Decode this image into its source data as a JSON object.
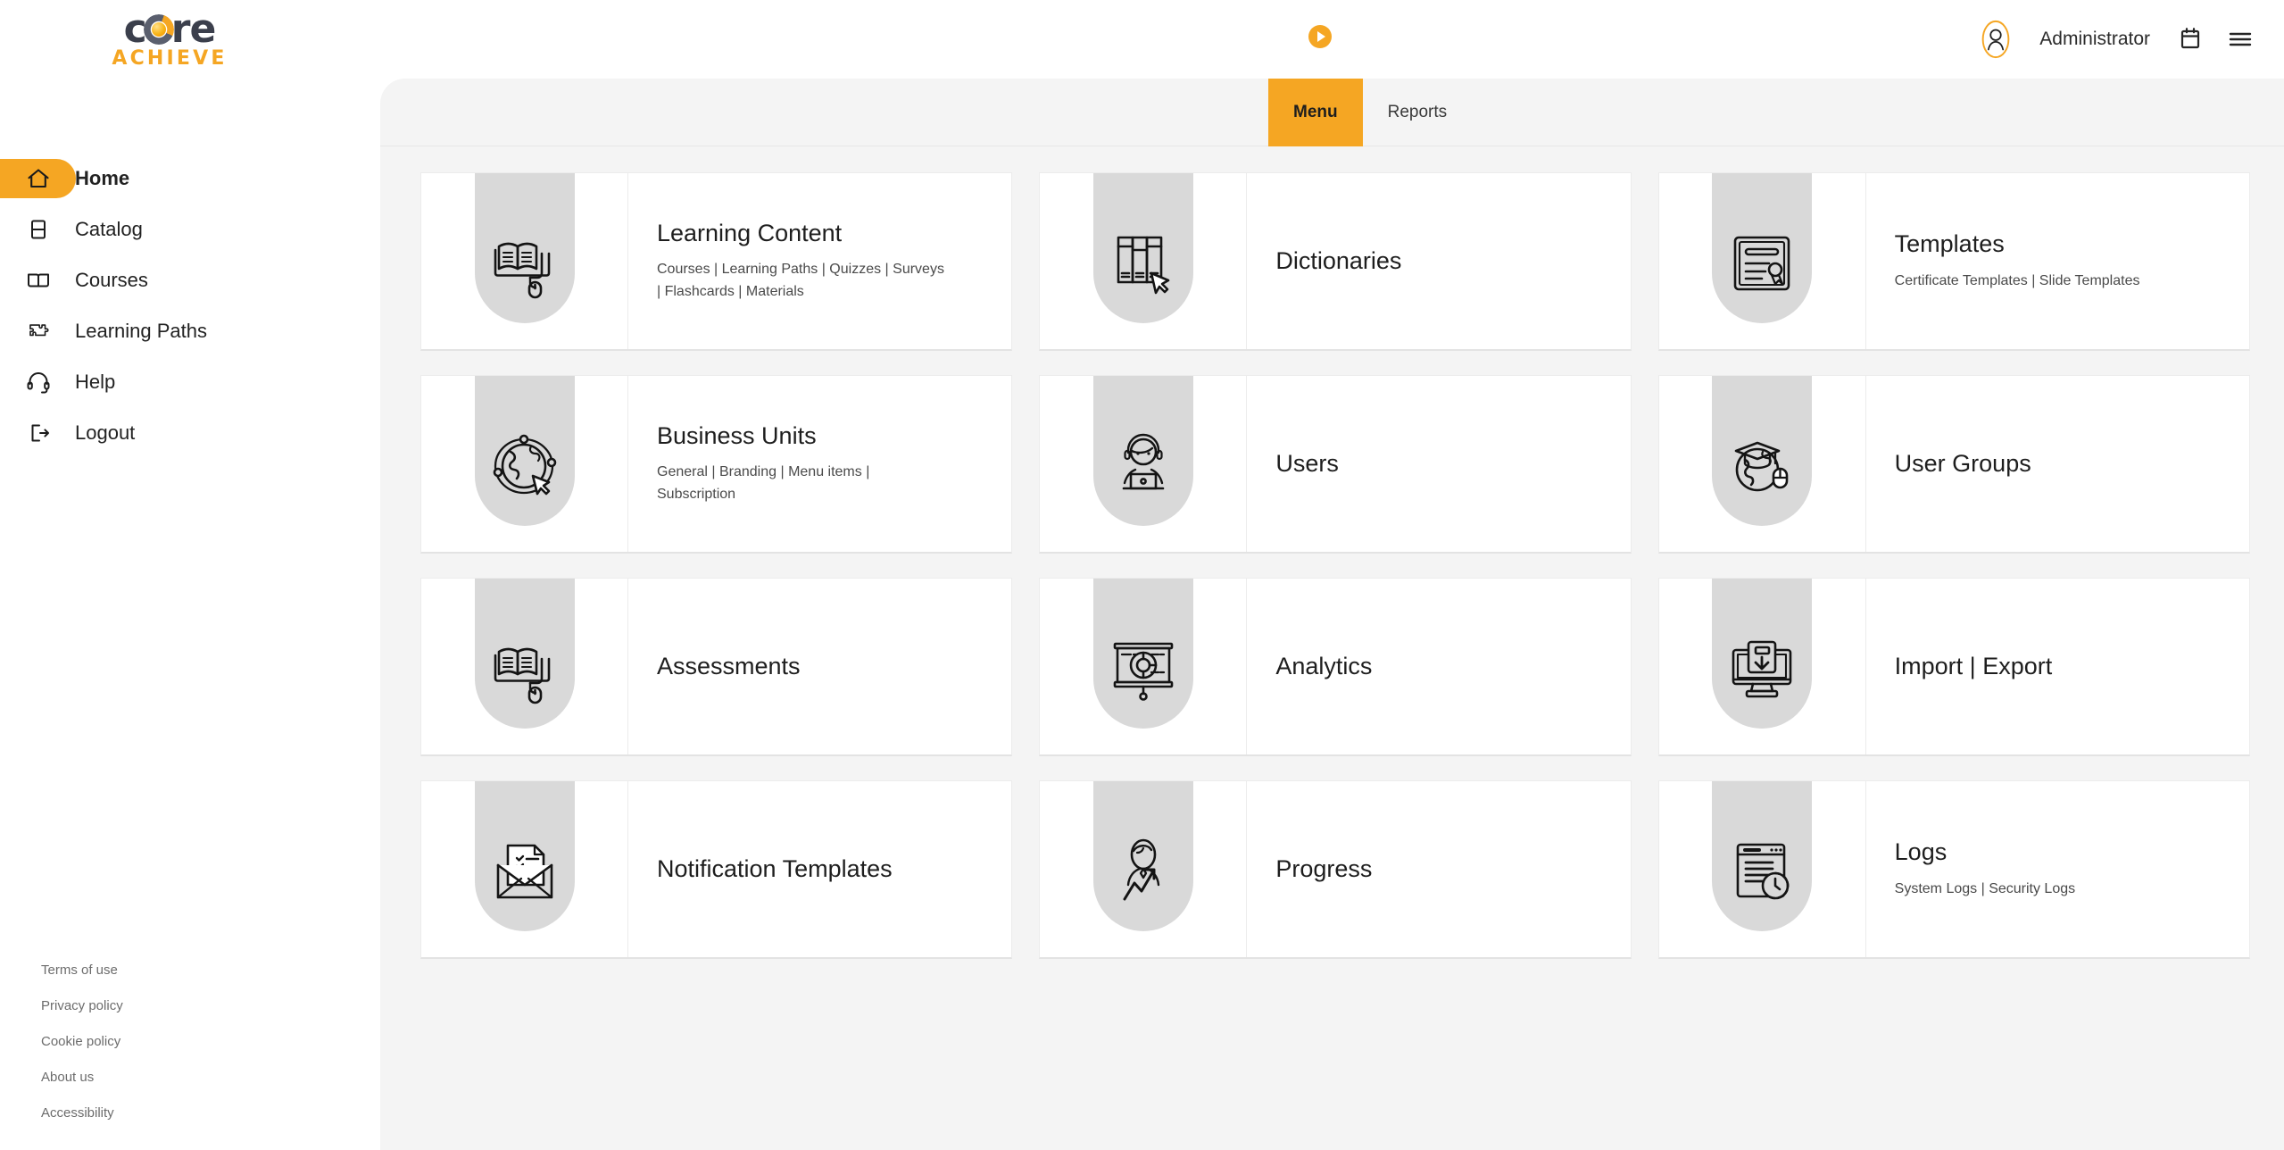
{
  "brand": {
    "logo_word": "c",
    "logo_word_tail": "re",
    "logo_sub": "ACHIEVE",
    "accent_color": "#f5a623",
    "logo_dark": "#3b3f4c"
  },
  "header": {
    "play_icon": "play-circle-icon",
    "avatar_icon": "user-avatar-icon",
    "user_name": "Administrator",
    "calendar_icon": "calendar-icon",
    "menu_icon": "hamburger-menu-icon"
  },
  "sidebar": {
    "items": [
      {
        "label": "Home",
        "icon": "home-icon",
        "active": true
      },
      {
        "label": "Catalog",
        "icon": "catalog-book-icon",
        "active": false
      },
      {
        "label": "Courses",
        "icon": "open-book-icon",
        "active": false
      },
      {
        "label": "Learning Paths",
        "icon": "puzzle-piece-icon",
        "active": false
      },
      {
        "label": "Help",
        "icon": "headset-icon",
        "active": false
      },
      {
        "label": "Logout",
        "icon": "logout-arrow-icon",
        "active": false
      }
    ],
    "footer_links": [
      {
        "label": "Terms of use"
      },
      {
        "label": "Privacy policy"
      },
      {
        "label": "Cookie policy"
      },
      {
        "label": "About us"
      },
      {
        "label": "Accessibility"
      }
    ]
  },
  "tabs": [
    {
      "label": "Menu",
      "active": true
    },
    {
      "label": "Reports",
      "active": false
    }
  ],
  "cards": [
    {
      "title": "Learning Content",
      "subtitle": "Courses | Learning Paths | Quizzes | Surveys | Flashcards | Materials",
      "icon": "book-mouse-icon"
    },
    {
      "title": "Dictionaries",
      "subtitle": "",
      "icon": "bookshelf-cursor-icon"
    },
    {
      "title": "Templates",
      "subtitle": "Certificate Templates | Slide Templates",
      "icon": "certificate-seal-icon"
    },
    {
      "title": "Business Units",
      "subtitle": "General | Branding | Menu items | Subscription",
      "icon": "globe-orbit-cursor-icon"
    },
    {
      "title": "Users",
      "subtitle": "",
      "icon": "user-headset-laptop-icon"
    },
    {
      "title": "User Groups",
      "subtitle": "",
      "icon": "globe-graduation-mouse-icon"
    },
    {
      "title": "Assessments",
      "subtitle": "",
      "icon": "book-mouse-icon"
    },
    {
      "title": "Analytics",
      "subtitle": "",
      "icon": "presentation-piechart-icon"
    },
    {
      "title": "Import | Export",
      "subtitle": "",
      "icon": "monitor-download-icon"
    },
    {
      "title": "Notification Templates",
      "subtitle": "",
      "icon": "envelope-checklist-icon"
    },
    {
      "title": "Progress",
      "subtitle": "",
      "icon": "person-growth-arrow-icon"
    },
    {
      "title": "Logs",
      "subtitle": "System Logs | Security Logs",
      "icon": "document-clock-icon"
    }
  ]
}
